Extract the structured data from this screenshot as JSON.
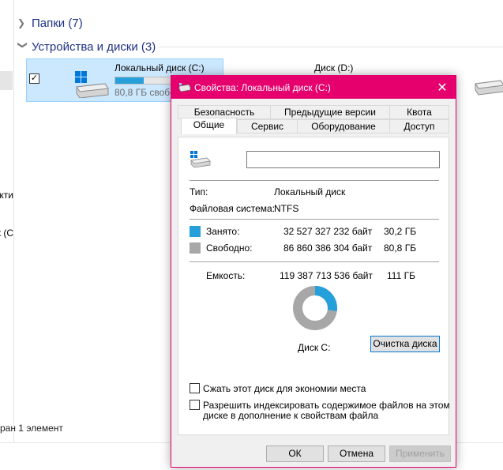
{
  "explorer": {
    "groups": [
      {
        "label": "Папки (7)"
      },
      {
        "label": "Устройства и диски (3)"
      }
    ],
    "drives": [
      {
        "name": "Локальный диск (C:)",
        "free_text": "80,8 ГБ свобо",
        "used_fraction": 0.27
      },
      {
        "name": "Диск (D:)"
      }
    ],
    "nav_fragments": [
      "екти",
      "к (C"
    ],
    "status_text": "ран 1 элемент"
  },
  "dialog": {
    "title": "Свойства: Локальный диск (C:)",
    "close_glyph": "✕",
    "tabs_row1": [
      "Безопасность",
      "Предыдущие версии",
      "Квота"
    ],
    "tabs_row2": [
      "Общие",
      "Сервис",
      "Оборудование",
      "Доступ"
    ],
    "active_tab": "Общие",
    "name_value": "",
    "type_label": "Тип:",
    "type_value": "Локальный диск",
    "fs_label": "Файловая система:",
    "fs_value": "NTFS",
    "used_label": "Занято:",
    "used_bytes": "32 527 327 232 байт",
    "used_gb": "30,2 ГБ",
    "free_label": "Свободно:",
    "free_bytes": "86 860 386 304 байт",
    "free_gb": "80,8 ГБ",
    "capacity_label": "Емкость:",
    "capacity_bytes": "119 387 713 536 байт",
    "capacity_gb": "111 ГБ",
    "disk_label": "Диск С:",
    "cleanup_button": "Очистка диска",
    "compress_label": "Сжать этот диск для экономии места",
    "index_label_line1": "Разрешить индексировать содержимое файлов на этом",
    "index_label_line2": "диске в дополнение к свойствам файла",
    "ok_button": "ОК",
    "cancel_button": "Отмена",
    "apply_button": "Применить",
    "colors": {
      "title_bar": "#e5006e",
      "used": "#26a0da",
      "free": "#a7a7a7"
    },
    "used_fraction": 0.2725
  }
}
